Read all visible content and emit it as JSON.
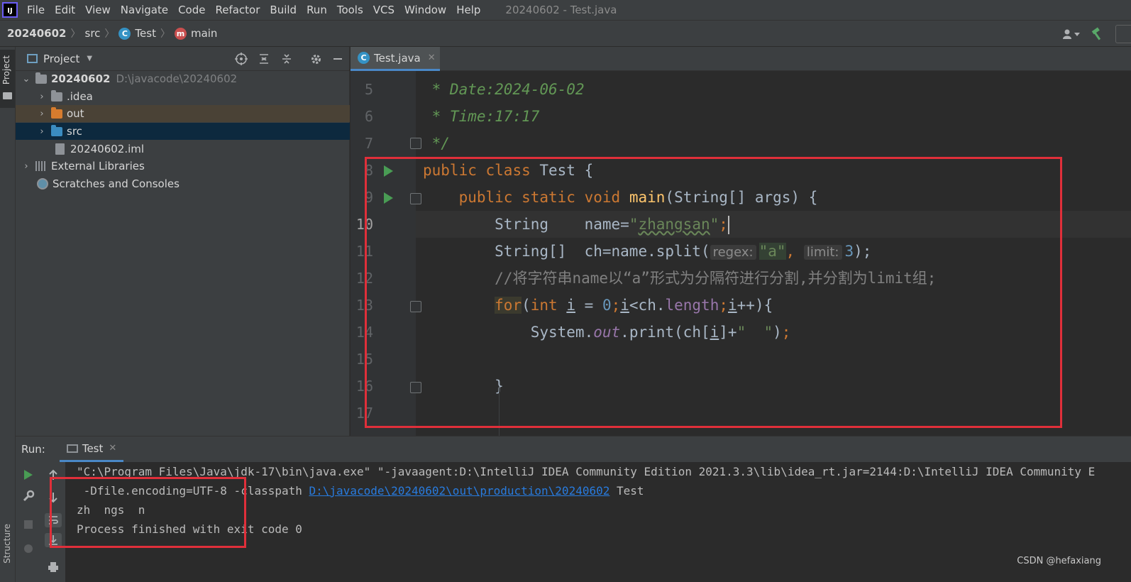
{
  "menubar": {
    "logo": "IJ",
    "items": [
      "File",
      "Edit",
      "View",
      "Navigate",
      "Code",
      "Refactor",
      "Build",
      "Run",
      "Tools",
      "VCS",
      "Window",
      "Help"
    ],
    "underline_letters": [
      "F",
      "E",
      "V",
      "N",
      "C",
      "R",
      "B",
      "u",
      "T",
      "S",
      "W",
      "H"
    ],
    "window_title": "20240602 - Test.java"
  },
  "breadcrumb": {
    "project": "20240602",
    "folder": "src",
    "class": "Test",
    "method": "main",
    "class_badge": "C",
    "method_badge": "m"
  },
  "project_panel": {
    "title": "Project",
    "tree": {
      "root_name": "20240602",
      "root_path": "D:\\javacode\\20240602",
      "idea": ".idea",
      "out": "out",
      "src": "src",
      "iml": "20240602.iml",
      "external_libraries": "External Libraries",
      "scratches": "Scratches and Consoles"
    }
  },
  "left_strip": {
    "project_label": "Project",
    "structure_label": "Structure"
  },
  "editor": {
    "tab_label": "Test.java",
    "line_numbers": [
      "5",
      "6",
      "7",
      "8",
      "9",
      "10",
      "11",
      "12",
      "13",
      "14",
      "15",
      "16",
      "17"
    ],
    "code": {
      "l5": " * Date:2024-06-02",
      "l6": " * Time:17:17",
      "l7": " */",
      "l8_kw1": "public",
      "l8_kw2": "class",
      "l8_rest": " Test {",
      "l9_kw1": "public",
      "l9_kw2": "static",
      "l9_kw3": "void",
      "l9_fn": "main",
      "l9_rest": "(String[] args) {",
      "l10_type": "String    name=",
      "l10_str1": "\"",
      "l10_strval": "zhangsan",
      "l10_str2": "\"",
      "l10_semi": ";",
      "l11_pre": "String[]  ch=name.split(",
      "l11_hint1": "regex:",
      "l11_str": "\"a\"",
      "l11_comma": ",",
      "l11_hint2": "limit:",
      "l11_num": "3",
      "l11_end": ");",
      "l12_comment": "//将字符串name以“a”形式为分隔符进行分割,并分割为limit组;",
      "l13_for": "for",
      "l13_open": "(",
      "l13_int": "int",
      "l13_i1": "i",
      "l13_eq": " = ",
      "l13_zero": "0",
      "l13_semi1": ";",
      "l13_i2": "i",
      "l13_mid": "<ch.",
      "l13_len": "length",
      "l13_semi2": ";",
      "l13_i3": "i",
      "l13_end": "++){",
      "l14_pre": "System.",
      "l14_out": "out",
      "l14_print": ".print(ch[",
      "l14_i": "i",
      "l14_plus": "]+",
      "l14_str": "\"  \"",
      "l14_close": ")",
      "l14_semi": ";",
      "l16": "}"
    }
  },
  "run_panel": {
    "label": "Run:",
    "tab_label": "Test",
    "console": {
      "line1": "\"C:\\Program Files\\Java\\jdk-17\\bin\\java.exe\" \"-javaagent:D:\\IntelliJ IDEA Community Edition 2021.3.3\\lib\\idea_rt.jar=2144:D:\\IntelliJ IDEA Community E",
      "line2_pre": " -Dfile.encoding=UTF-8 -classpath ",
      "line2_link": "D:\\javacode\\20240602\\out\\production\\20240602",
      "line2_post": " Test",
      "line3": "zh  ngs  n",
      "line4": "Process finished with exit code 0"
    }
  },
  "watermark": "CSDN @hefaxiang",
  "colors": {
    "background": "#2b2b2b",
    "keyword": "#cc7832",
    "string": "#6a8759",
    "method": "#ffc66d",
    "number": "#6897bb",
    "doc_comment": "#629755",
    "highlight_box": "#e02f3a",
    "link": "#287bde"
  }
}
